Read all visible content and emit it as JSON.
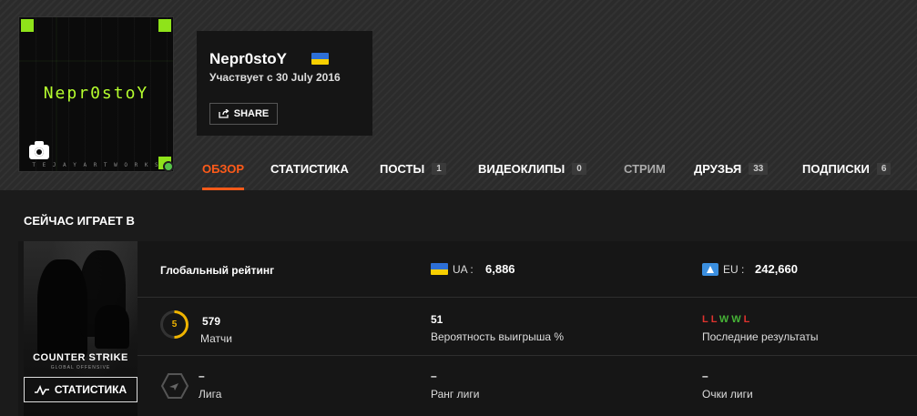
{
  "profile": {
    "avatar_text": "Nepr0stoY",
    "avatar_caption": "T E J A Y   A R T W O R K S",
    "username": "Nepr0stoY",
    "joined": "Участвует с 30 July 2016",
    "share_label": "SHARE",
    "country_flag": "ukraine-flag",
    "online_status_color": "#55c34a"
  },
  "nav": {
    "tabs": [
      {
        "label": "ОБЗОР",
        "active": true
      },
      {
        "label": "СТАТИСТИКА"
      },
      {
        "label": "ПОСТЫ",
        "count": "1"
      },
      {
        "label": "ВИДЕОКЛИПЫ",
        "count": "0"
      },
      {
        "label": "СТРИМ"
      },
      {
        "label": "ДРУЗЬЯ",
        "count": "33"
      },
      {
        "label": "ПОДПИСКИ",
        "count": "6"
      }
    ],
    "accent_color": "#ff5a19"
  },
  "now_playing": {
    "title": "СЕЙЧАС ИГРАЕТ В",
    "game_logo": "COUNTER STRIKE",
    "game_sub": "GLOBAL OFFENSIVE",
    "stats_button": "СТАТИСТИКА",
    "global_rating_label": "Глобальный рейтинг",
    "ua_label": "UA :",
    "ua_value": "6,886",
    "eu_label": "EU :",
    "eu_value": "242,660",
    "level": "5",
    "matches_value": "579",
    "matches_label": "Матчи",
    "winrate_value": "51",
    "winrate_label": "Вероятность выигрыша %",
    "recent_results": [
      "L",
      "L",
      "W",
      "W",
      "L"
    ],
    "recent_label": "Последние результаты",
    "league_value": "–",
    "league_label": "Лига",
    "league_rank_value": "–",
    "league_rank_label": "Ранг лиги",
    "league_points_value": "–",
    "league_points_label": "Очки лиги"
  }
}
